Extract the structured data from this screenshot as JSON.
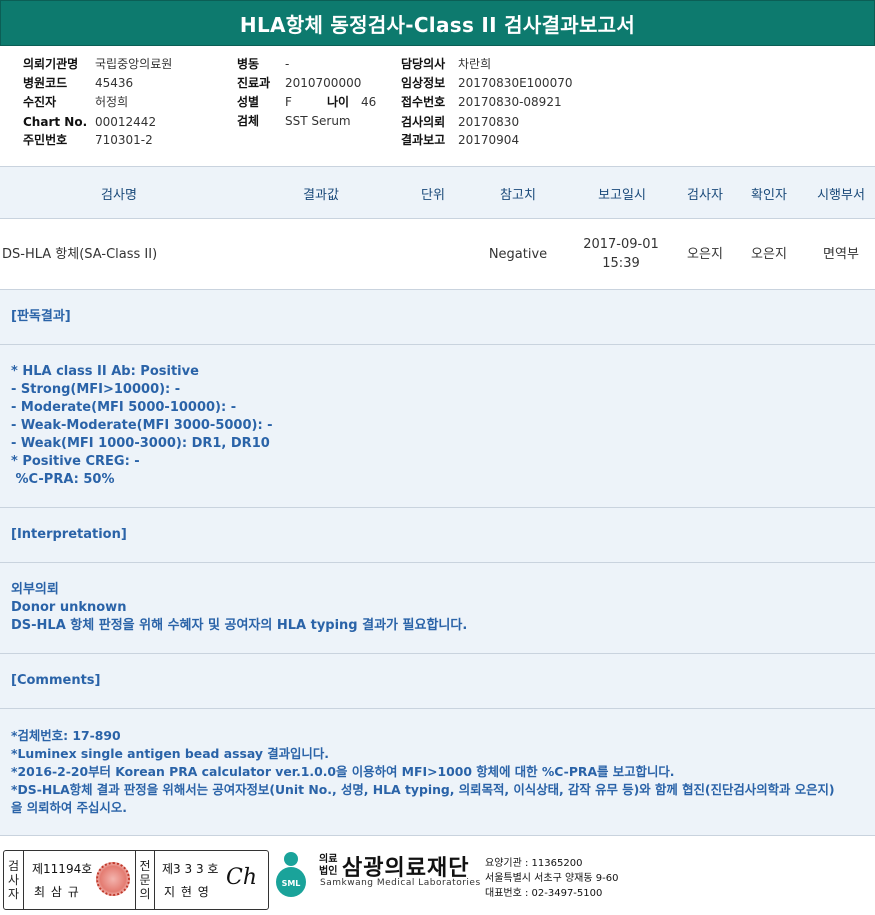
{
  "title": "HLA항체 동정검사-Class II 검사결과보고서",
  "info": {
    "col1": [
      {
        "label": "의뢰기관명",
        "value": "국립중앙의료원"
      },
      {
        "label": "병원코드",
        "value": "45436"
      },
      {
        "label": "수진자",
        "value": "허정희"
      },
      {
        "label": "Chart No.",
        "value": "00012442"
      },
      {
        "label": "주민번호",
        "value": "710301-2"
      }
    ],
    "col2": [
      {
        "label": "병동",
        "value": "-"
      },
      {
        "label": "진료과",
        "value": "2010700000"
      },
      {
        "label": "성별",
        "value": "F"
      },
      {
        "label": "검체",
        "value": "SST Serum"
      }
    ],
    "age": {
      "label": "나이",
      "value": "46"
    },
    "col3": [
      {
        "label": "담당의사",
        "value": "차란희"
      },
      {
        "label": "임상정보",
        "value": "20170830E100070"
      },
      {
        "label": "접수번호",
        "value": "20170830-08921"
      },
      {
        "label": "검사의뢰",
        "value": "20170830"
      },
      {
        "label": "결과보고",
        "value": "20170904"
      }
    ]
  },
  "table": {
    "headers": [
      "검사명",
      "결과값",
      "단위",
      "참고치",
      "보고일시",
      "검사자",
      "확인자",
      "시행부서"
    ],
    "row": {
      "test_name": "DS-HLA 항체(SA-Class II)",
      "result": "",
      "unit": "",
      "reference": "Negative",
      "report_date": "2017-09-01",
      "report_time": "15:39",
      "tester": "오은지",
      "confirmer": "오은지",
      "department": "면역부"
    }
  },
  "sections": {
    "reading_header": "[판독결과]",
    "reading_lines": [
      "* HLA class II Ab: Positive",
      "- Strong(MFI>10000): -",
      "- Moderate(MFI 5000-10000): -",
      "- Weak-Moderate(MFI 3000-5000): -",
      "- Weak(MFI 1000-3000): DR1, DR10",
      "* Positive CREG: -",
      " %C-PRA: 50%"
    ],
    "interpretation_header": "[Interpretation]",
    "interpretation_lines": [
      "외부의뢰",
      "Donor unknown",
      "DS-HLA 항체 판정을 위해 수혜자 및 공여자의 HLA typing 결과가 필요합니다."
    ],
    "comments_header": "[Comments]",
    "comments_lines": [
      "*검체번호: 17-890",
      "*Luminex single antigen bead assay 결과입니다.",
      "*2016-2-20부터 Korean PRA calculator ver.1.0.0을 이용하여 MFI>1000 항체에 대한 %C-PRA를 보고합니다.",
      "*DS-HLA항체 결과 판정을 위해서는 공여자정보(Unit No., 성명, HLA typing, 의뢰목적, 이식상태, 감작 유무 등)와 함께 협진(진단검사의학과 오은지)",
      "을 의뢰하여 주십시오."
    ]
  },
  "footer": {
    "tester_label": [
      "검",
      "사",
      "자"
    ],
    "tester_no": "제11194호",
    "tester_name": "최 삼 규",
    "specialist_label": [
      "전",
      "문",
      "의"
    ],
    "specialist_no": "제3 3 3 호",
    "specialist_name": "지 현 영",
    "signature": "Ch",
    "logo_text": "SML",
    "corp_type": [
      "의료",
      "법인"
    ],
    "corp_name": "삼광의료재단",
    "corp_eng": "Samkwang Medical Laboratories",
    "code_line": "요양기관 : 11365200",
    "address": "서울특별시 서초구 양재동 9-60",
    "phone": "대표번호 : 02-3497-5100"
  }
}
